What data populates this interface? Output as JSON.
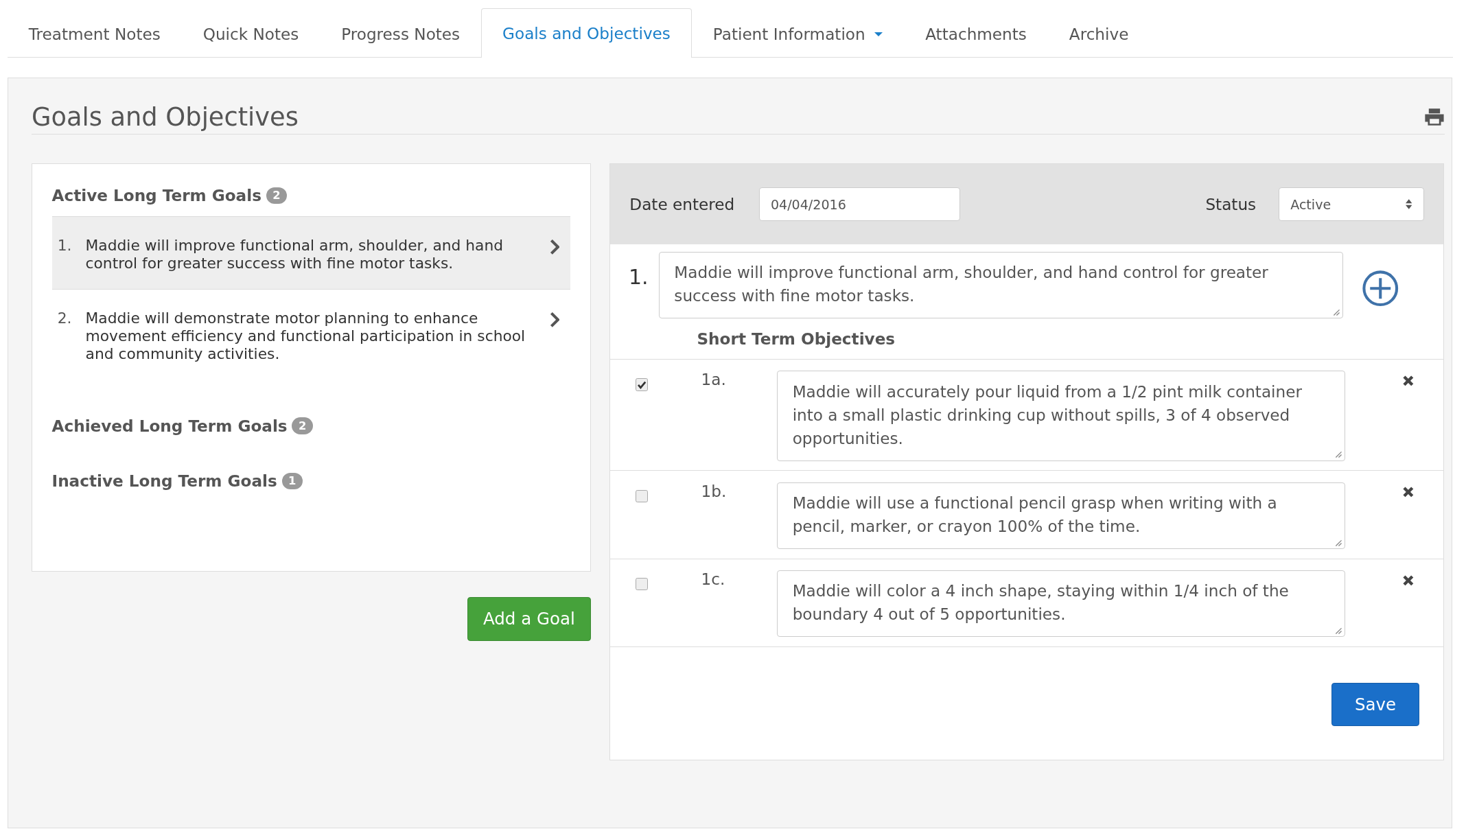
{
  "tabs": [
    {
      "label": "Treatment Notes",
      "selected": false,
      "kind": "plain"
    },
    {
      "label": "Quick Notes",
      "selected": false,
      "kind": "plain"
    },
    {
      "label": "Progress Notes",
      "selected": false,
      "kind": "plain"
    },
    {
      "label": "Goals and Objectives",
      "selected": true,
      "kind": "plain"
    },
    {
      "label": "Patient Information",
      "selected": false,
      "kind": "dropdown"
    },
    {
      "label": "Attachments",
      "selected": false,
      "kind": "plain"
    },
    {
      "label": "Archive",
      "selected": false,
      "kind": "plain"
    }
  ],
  "panel": {
    "title": "Goals and Objectives"
  },
  "goal_groups": [
    {
      "title": "Active Long Term Goals",
      "count": "2",
      "goals": [
        {
          "number": "1.",
          "text": "Maddie will improve functional arm, shoulder, and hand control for greater success with fine motor tasks.",
          "selected": true
        },
        {
          "number": "2.",
          "text": "Maddie will demonstrate motor planning to enhance movement efficiency and functional participation in school and community activities.",
          "selected": false
        }
      ]
    },
    {
      "title": "Achieved Long Term Goals",
      "count": "2"
    },
    {
      "title": "Inactive Long Term Goals",
      "count": "1"
    }
  ],
  "add_goal_button": "Add a Goal",
  "editor": {
    "date_label": "Date entered",
    "date_value": "04/04/2016",
    "status_label": "Status",
    "status_value": "Active",
    "goal_number": "1.",
    "goal_text": "Maddie will improve functional arm, shoulder, and hand control for greater success with fine motor tasks.",
    "objectives_heading": "Short Term Objectives",
    "objectives": [
      {
        "label": "1a.",
        "checked": true,
        "text": "Maddie will accurately pour liquid from a 1/2 pint milk container into a small plastic drinking cup without spills, 3 of 4 observed opportunities."
      },
      {
        "label": "1b.",
        "checked": false,
        "text": "Maddie will use a functional pencil grasp when writing with a pencil, marker, or crayon 100% of the time."
      },
      {
        "label": "1c.",
        "checked": false,
        "text": "Maddie will color a 4 inch shape, staying within 1/4 inch of the boundary 4 out of 5 opportunities."
      }
    ],
    "save_button": "Save"
  }
}
